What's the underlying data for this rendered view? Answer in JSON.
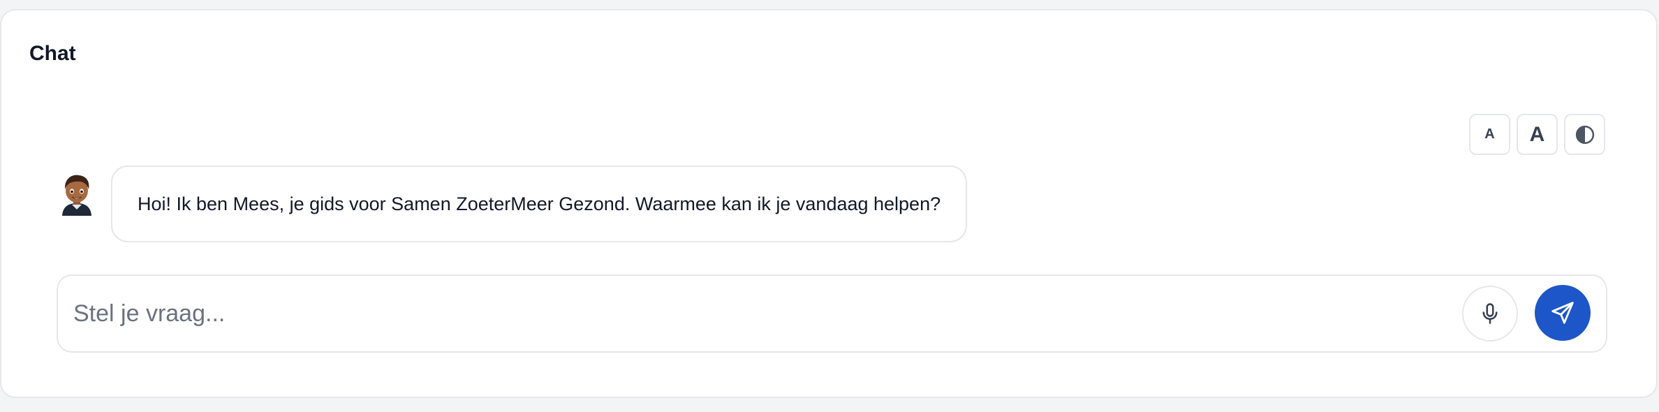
{
  "chat": {
    "title": "Chat"
  },
  "accessibility": {
    "decrease_font_label": "A",
    "increase_font_label": "A",
    "contrast_icon": "contrast-icon"
  },
  "messages": [
    {
      "sender": "bot",
      "avatar": "avatar-icon",
      "text": "Hoi! Ik ben Mees, je gids voor Samen ZoeterMeer Gezond. Waarmee kan ik je vandaag helpen?"
    }
  ],
  "composer": {
    "value": "",
    "placeholder": "Stel je vraag...",
    "mic_icon": "microphone-icon",
    "send_icon": "send-icon"
  },
  "colors": {
    "page_background": "#f3f4f6",
    "card_background": "#ffffff",
    "border": "#e5e7eb",
    "send_button": "#1d56c8",
    "title_text": "#111827",
    "placeholder_text": "#6b7280"
  }
}
